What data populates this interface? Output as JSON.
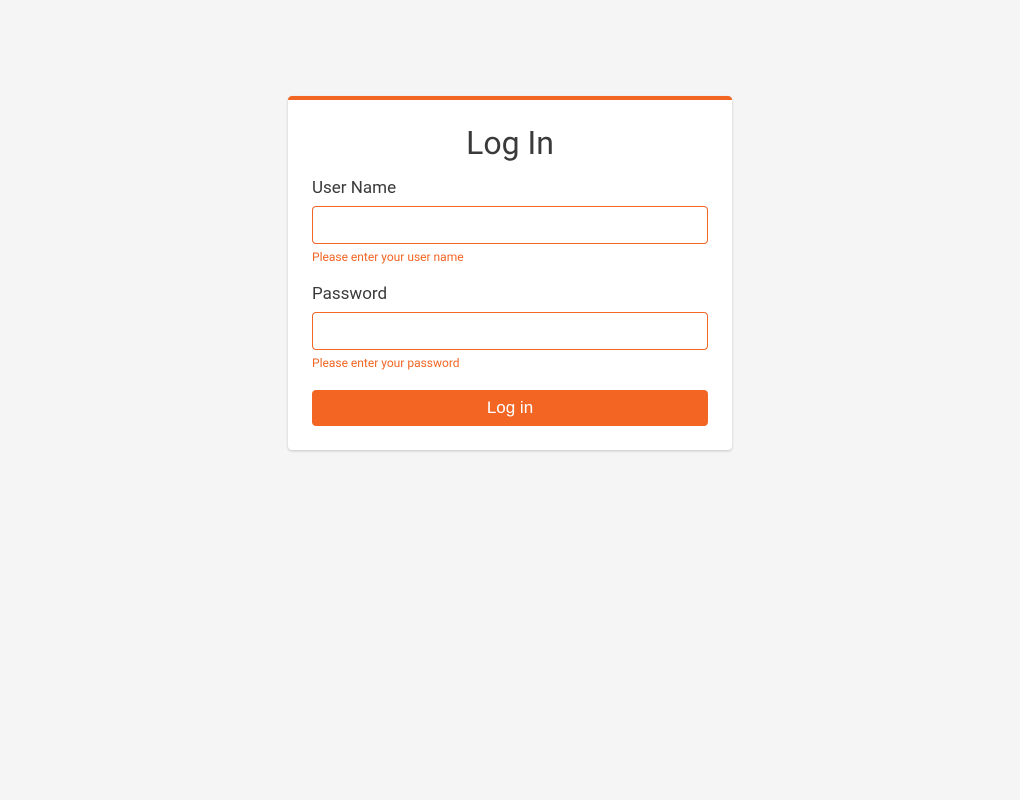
{
  "title": "Log In",
  "form": {
    "username": {
      "label": "User Name",
      "value": "",
      "error": "Please enter your user name"
    },
    "password": {
      "label": "Password",
      "value": "",
      "error": "Please enter your password"
    },
    "submit_label": "Log in"
  },
  "colors": {
    "accent": "#f26522",
    "background": "#f5f5f5",
    "card": "#ffffff",
    "text": "#3a3a3a"
  }
}
